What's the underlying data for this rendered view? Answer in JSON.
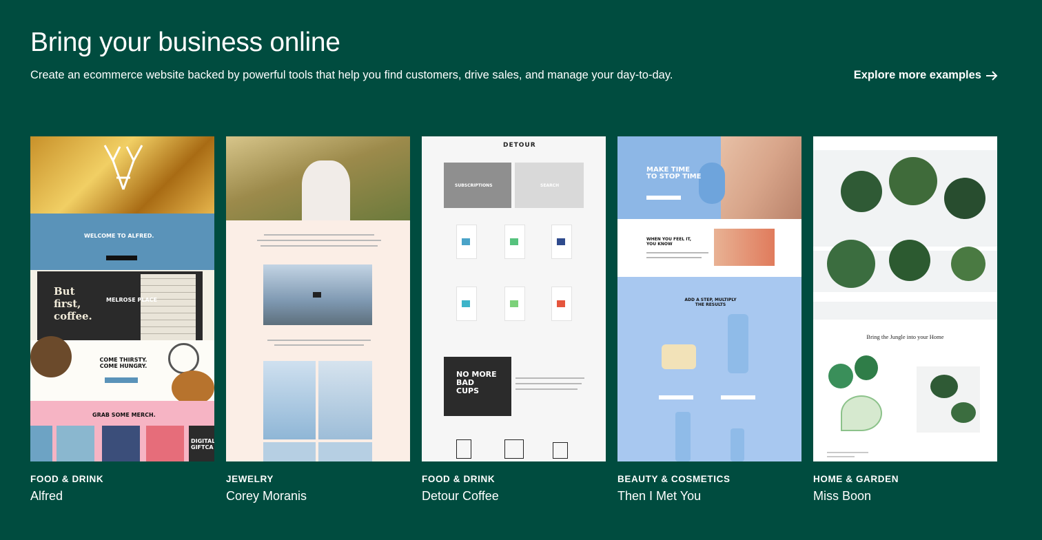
{
  "header": {
    "title": "Bring your business online",
    "subtitle": "Create an ecommerce website backed by powerful tools that help you find customers, drive sales, and manage your day-to-day.",
    "explore_label": "Explore more examples",
    "explore_icon": "arrow-right-icon"
  },
  "colors": {
    "background": "#004c3f",
    "text": "#ffffff"
  },
  "examples": [
    {
      "category": "FOOD & DRINK",
      "name": "Alfred",
      "preview": {
        "welcome": "WELCOME TO ALFRED.",
        "sign": "But first, coffee.",
        "location": "MELROSE PLACE",
        "tagline": "COME THIRSTY. COME HUNGRY.",
        "merch": "GRAB SOME MERCH.",
        "gift": "DIGITAL GIFTCA"
      }
    },
    {
      "category": "JEWELRY",
      "name": "Corey Moranis",
      "preview": {}
    },
    {
      "category": "FOOD & DRINK",
      "name": "Detour Coffee",
      "preview": {
        "brand": "DETOUR",
        "subscriptions": "SUBSCRIPTIONS",
        "search": "SEARCH",
        "cups": "NO MORE BAD CUPS"
      }
    },
    {
      "category": "BEAUTY & COSMETICS",
      "name": "Then I Met You",
      "preview": {
        "hero": "MAKE TIME TO STOP TIME",
        "feel": "WHEN YOU FEEL IT, YOU KNOW",
        "step": "ADD A STEP, MULTIPLY THE RESULTS"
      }
    },
    {
      "category": "HOME & GARDEN",
      "name": "Miss Boon",
      "preview": {
        "tagline": "Bring the Jungle into your Home"
      }
    }
  ]
}
